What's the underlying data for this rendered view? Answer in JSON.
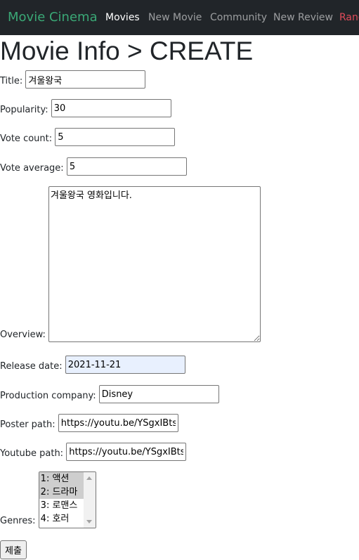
{
  "navbar": {
    "brand": "Movie Cinema",
    "links": [
      {
        "label": "Movies",
        "active": true
      },
      {
        "label": "New Movie",
        "active": false
      },
      {
        "label": "Community",
        "active": false
      },
      {
        "label": "New Review",
        "active": false
      },
      {
        "label": "Random",
        "active": false
      }
    ]
  },
  "page": {
    "title": "Movie Info > CREATE"
  },
  "form": {
    "title": {
      "label": "Title:",
      "value": "겨울왕국"
    },
    "popularity": {
      "label": "Popularity:",
      "value": "30"
    },
    "vote_count": {
      "label": "Vote count:",
      "value": "5"
    },
    "vote_average": {
      "label": "Vote average:",
      "value": "5"
    },
    "overview": {
      "label": "Overview:",
      "value": "겨울왕국 영화입니다."
    },
    "release_date": {
      "label": "Release date:",
      "value": "2021-11-21"
    },
    "production_company": {
      "label": "Production company:",
      "value": "Disney"
    },
    "poster_path": {
      "label": "Poster path:",
      "value": "https://youtu.be/YSgxIBtsBEA"
    },
    "youtube_path": {
      "label": "Youtube path:",
      "value": "https://youtu.be/YSgxIBtsBEA"
    },
    "genres": {
      "label": "Genres:",
      "options": [
        {
          "label": "1: 액션",
          "selected": true
        },
        {
          "label": "2: 드라마",
          "selected": true
        },
        {
          "label": "3: 로맨스",
          "selected": false
        },
        {
          "label": "4: 호러",
          "selected": false
        }
      ]
    },
    "submit_label": "제출"
  },
  "colors": {
    "navbar_bg": "#212529",
    "brand": "#3aa876",
    "danger_link": "#e24b5a",
    "autofill_bg": "#e8f0fe"
  }
}
